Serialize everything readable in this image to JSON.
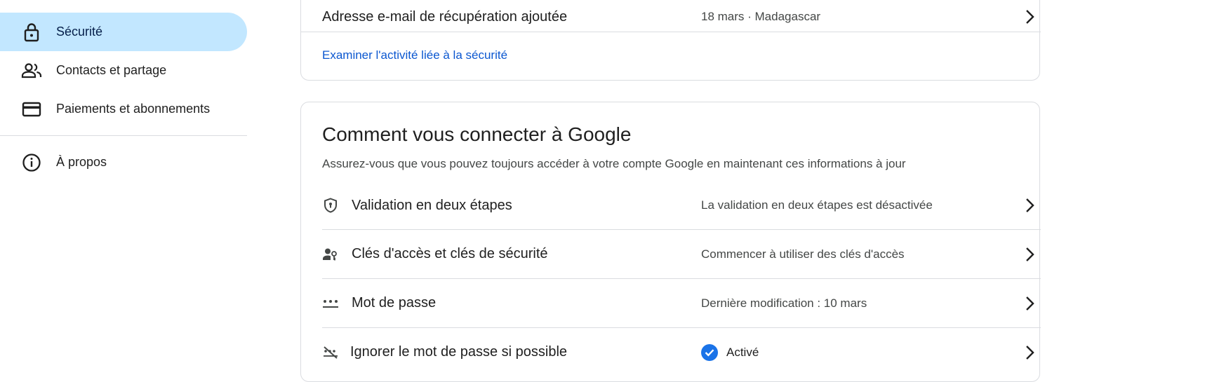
{
  "sidebar": {
    "items": [
      {
        "label": "Sécurité",
        "icon": "lock-icon",
        "active": true
      },
      {
        "label": "Contacts et partage",
        "icon": "people-icon",
        "active": false
      },
      {
        "label": "Paiements et abonnements",
        "icon": "credit-card-icon",
        "active": false
      }
    ],
    "footer_items": [
      {
        "label": "À propos",
        "icon": "info-icon"
      }
    ]
  },
  "recent_activity": {
    "rows": [
      {
        "title": "Adresse e-mail de récupération ajoutée",
        "value": "18 mars · Madagascar"
      }
    ],
    "link_label": "Examiner l'activité liée à la sécurité"
  },
  "signin_section": {
    "title": "Comment vous connecter à Google",
    "subtitle": "Assurez-vous que vous pouvez toujours accéder à votre compte Google en maintenant ces informations à jour",
    "rows": [
      {
        "title": "Validation en deux étapes",
        "value": "La validation en deux étapes est désactivée",
        "icon": "shield-icon"
      },
      {
        "title": "Clés d'accès et clés de sécurité",
        "value": "Commencer à utiliser des clés d'accès",
        "icon": "passkey-icon"
      },
      {
        "title": "Mot de passe",
        "value": "Dernière modification : 10 mars",
        "icon": "password-icon"
      },
      {
        "title": "Ignorer le mot de passe si possible",
        "value": "Activé",
        "icon": "skip-password-icon",
        "status_icon": "check-circle-icon"
      }
    ]
  },
  "colors": {
    "active_bg": "#c2e7ff",
    "link": "#0b57d0",
    "check": "#1a73e8",
    "divider": "#dadce0"
  }
}
